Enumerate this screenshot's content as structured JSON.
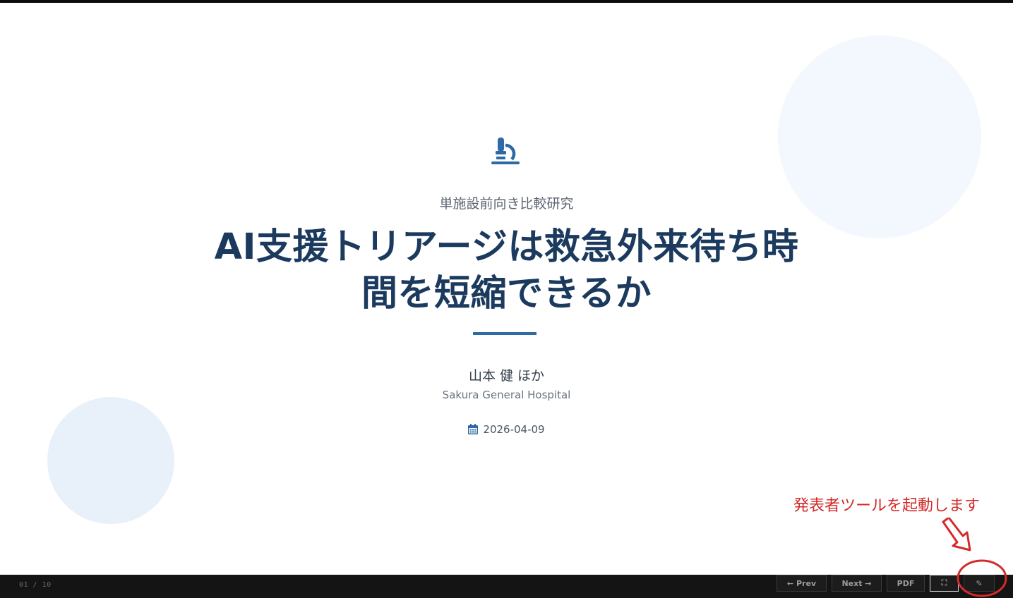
{
  "slide": {
    "kicker": "単施設前向き比較研究",
    "title_line1": "AI支援トリアージは救急外来待ち時",
    "title_line2": "間を短縮できるか",
    "author": "山本 健 ほか",
    "affiliation": "Sakura General Hospital",
    "date": "2026-04-09",
    "icons": {
      "hero": "microscope-icon",
      "date": "calendar-icon"
    }
  },
  "annotation": {
    "text": "発表者ツールを起動します"
  },
  "footer": {
    "counter": "01 / 10",
    "prev_label": "← Prev",
    "next_label": "Next →",
    "pdf_label": "PDF",
    "fullscreen_label": "⛶",
    "presenter_label": "✎"
  },
  "colors": {
    "title": "#1b3a5e",
    "accent": "#2e6aa6",
    "annotation": "#d42a2a",
    "footer_bg": "#141414"
  }
}
